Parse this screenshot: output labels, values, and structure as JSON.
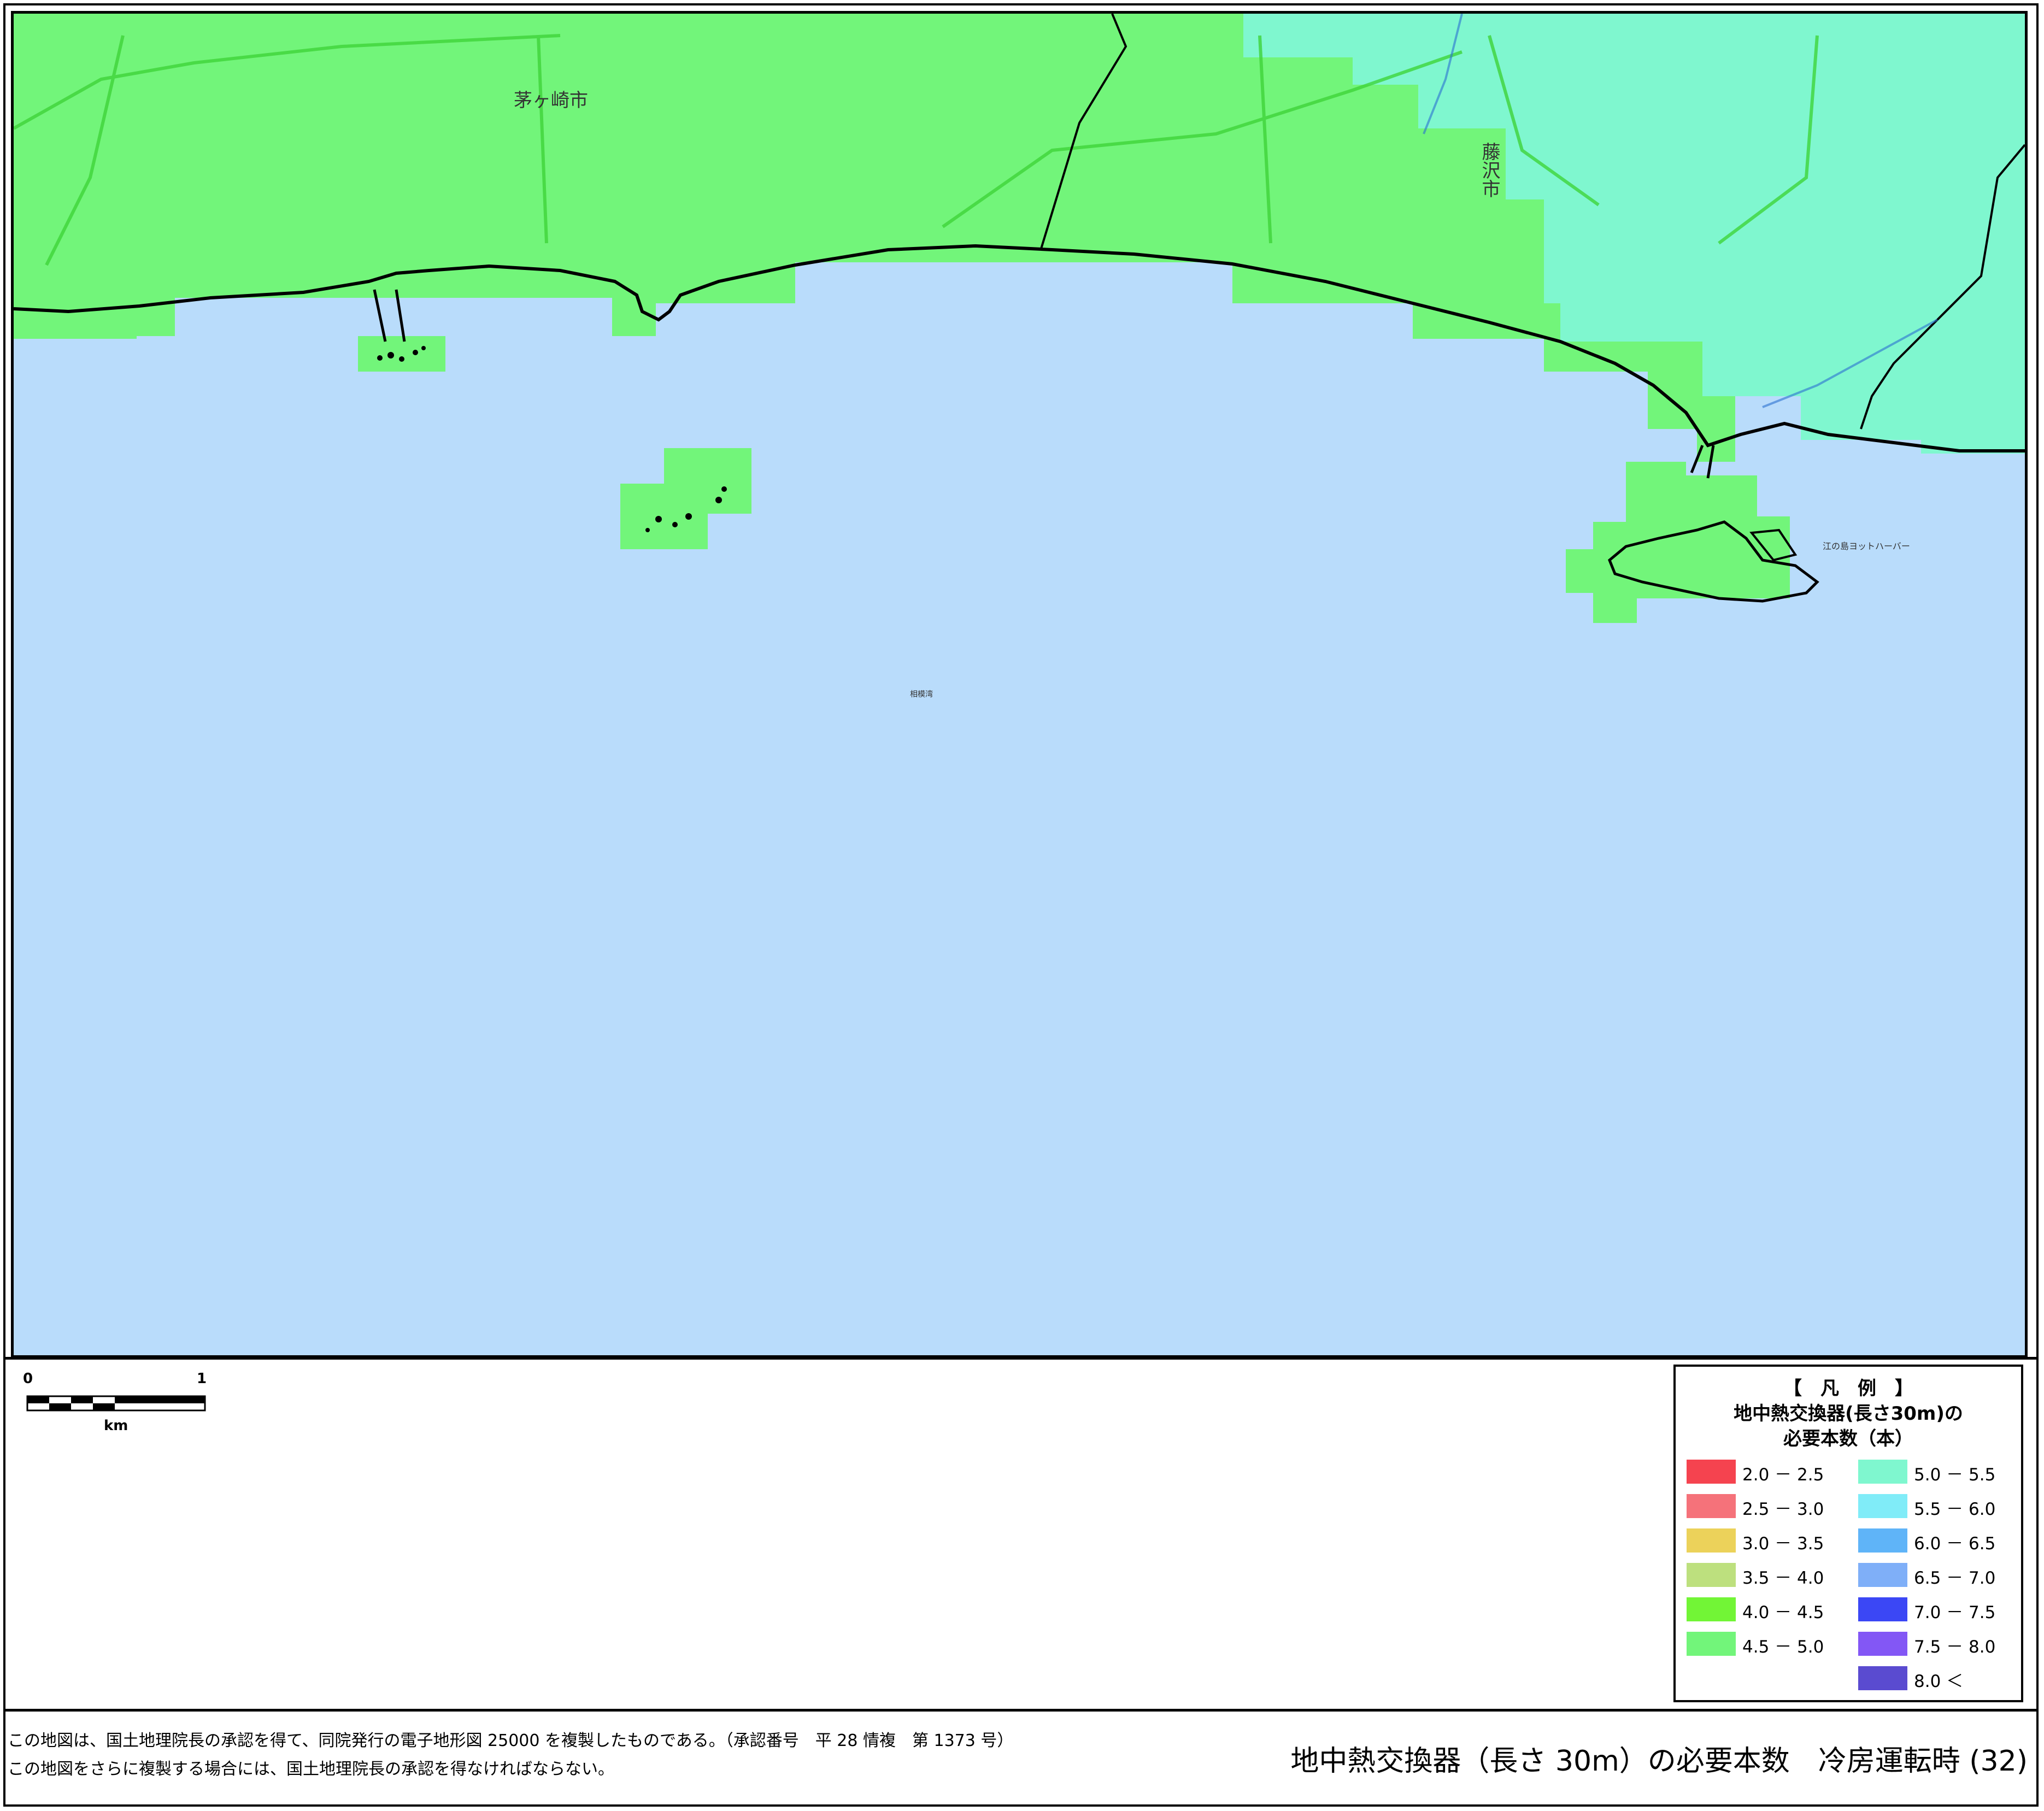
{
  "map": {
    "place_labels": [
      {
        "name": "茅ヶ崎市",
        "id": "chigasaki"
      },
      {
        "name": "藤沢市",
        "id": "fujisawa"
      },
      {
        "name": "江の島ヨットハーバー",
        "id": "enoshima-harbor"
      },
      {
        "name": "相模湾",
        "id": "sagami-bay"
      }
    ],
    "colors": {
      "sea": "#b9dcfb",
      "land_4_5_5_0": "#72f57a",
      "land_5_0_5_5": "#7ff7cf",
      "coastline": "#000000"
    }
  },
  "scale_bar": {
    "start": "0",
    "end": "1",
    "unit": "km"
  },
  "legend": {
    "bracket_title": "【　凡　例　】",
    "title_line1": "地中熱交換器(長さ30m)の",
    "title_line2": "必要本数（本）",
    "items": [
      {
        "label": "2.0 － 2.5",
        "color": "#f5434f"
      },
      {
        "label": "2.5 － 3.0",
        "color": "#f5727a"
      },
      {
        "label": "3.0 － 3.5",
        "color": "#ecd25a"
      },
      {
        "label": "3.5 － 4.0",
        "color": "#bde07e"
      },
      {
        "label": "4.0 － 4.5",
        "color": "#72f536"
      },
      {
        "label": "4.5 － 5.0",
        "color": "#72f57a"
      },
      {
        "label": "5.0 － 5.5",
        "color": "#7ff7cf"
      },
      {
        "label": "5.5 － 6.0",
        "color": "#80ecf8"
      },
      {
        "label": "6.0 － 6.5",
        "color": "#5fb4f8"
      },
      {
        "label": "6.5 － 7.0",
        "color": "#7faff8"
      },
      {
        "label": "7.0 － 7.5",
        "color": "#3b47f5"
      },
      {
        "label": "7.5 － 8.0",
        "color": "#8357f5"
      },
      {
        "label": "8.0 ＜",
        "color": "#5a4bd0"
      }
    ]
  },
  "footer": {
    "note1": "この地図は、国土地理院長の承認を得て、同院発行の電子地形図 25000 を複製したものである。（承認番号　平 28 情複　第 1373 号）",
    "note2": "この地図をさらに複製する場合には、国土地理院長の承認を得なければならない。",
    "title": "地中熱交換器（長さ 30m）の必要本数　冷房運転時 (32)"
  }
}
